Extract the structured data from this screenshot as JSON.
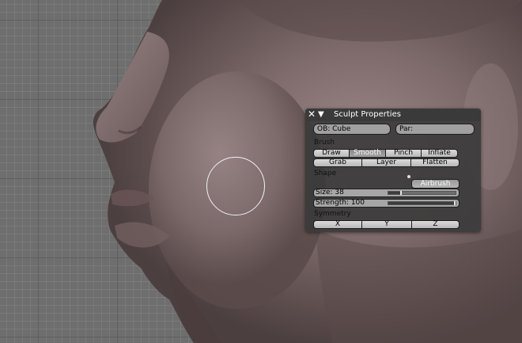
{
  "panel": {
    "title": "Sculpt Properties",
    "close_icon": "close-icon",
    "collapse_icon": "collapse-triangle-icon",
    "object_field": "OB: Cube",
    "parent_field": "Par:",
    "brush_label": "Brush",
    "brush_row1": [
      "Draw",
      "Smooth",
      "Pinch",
      "Inflate"
    ],
    "brush_row2": [
      "Grab",
      "Layer",
      "Flatten"
    ],
    "active_brush": "Smooth",
    "shape_label": "Shape",
    "airbrush_label": "Airbrush",
    "size_label": "Size: 38",
    "size_fraction": 0.2,
    "strength_label": "Strength: 100",
    "strength_fraction": 1.0,
    "symmetry_label": "Symmetry",
    "symmetry_buttons": [
      "X",
      "Y",
      "Z"
    ]
  },
  "colors": {
    "model_skin": "#8a7474",
    "panel_bg": "#3a3a3a",
    "grid_bg": "#6e6e6e"
  }
}
